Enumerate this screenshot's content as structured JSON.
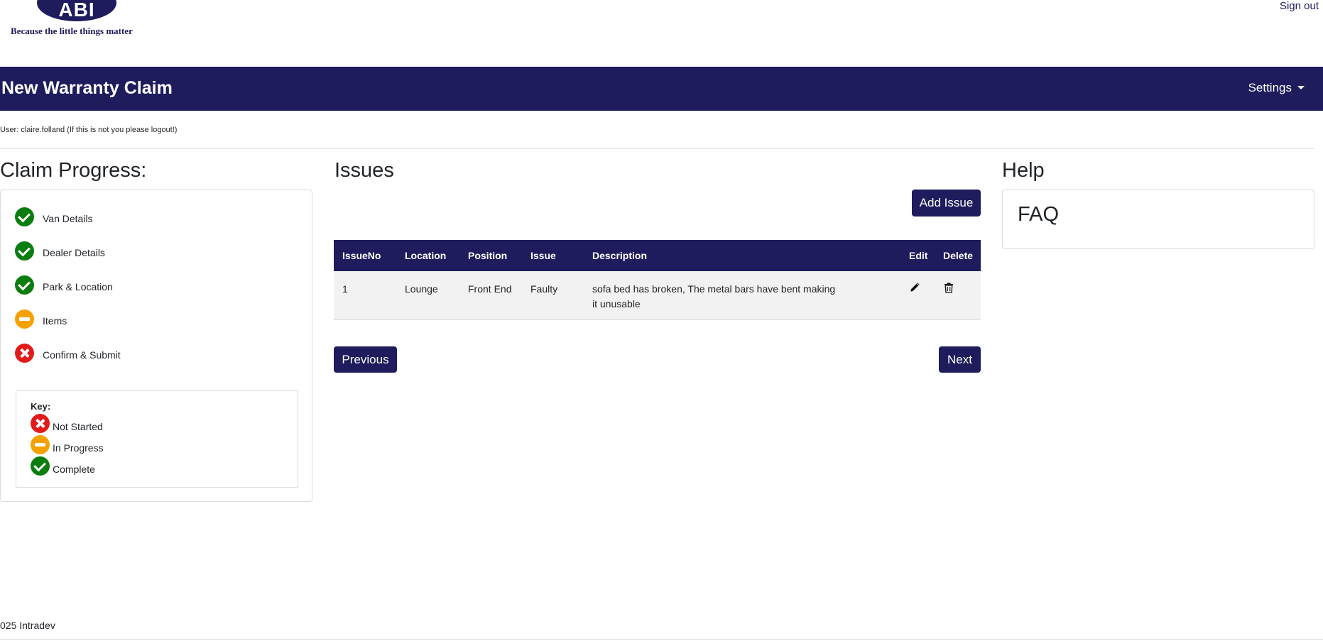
{
  "brand": {
    "logo_text": "ABI",
    "tagline": "Because the little things matter"
  },
  "header": {
    "signout_label": "Sign out"
  },
  "navbar": {
    "title": "New Warranty Claim",
    "settings_label": "Settings"
  },
  "user_line": "User: claire.folland (If this is not you please logout!)",
  "claim_progress": {
    "title": "Claim Progress:",
    "steps": [
      {
        "label": "Van Details",
        "status": "complete"
      },
      {
        "label": "Dealer Details",
        "status": "complete"
      },
      {
        "label": "Park & Location",
        "status": "complete"
      },
      {
        "label": "Items",
        "status": "in-progress"
      },
      {
        "label": "Confirm & Submit",
        "status": "not-started"
      }
    ],
    "key": {
      "title": "Key:",
      "items": [
        {
          "label": "Not Started",
          "status": "not-started"
        },
        {
          "label": "In Progress",
          "status": "in-progress"
        },
        {
          "label": "Complete",
          "status": "complete"
        }
      ]
    }
  },
  "issues": {
    "title": "Issues",
    "add_label": "Add Issue",
    "columns": [
      "IssueNo",
      "Location",
      "Position",
      "Issue",
      "Description",
      "Edit",
      "Delete"
    ],
    "rows": [
      {
        "issue_no": "1",
        "location": "Lounge",
        "position": "Front End",
        "issue": "Faulty",
        "description_line1": "sofa bed has broken, The metal bars have bent making",
        "description_line2": "it unusable"
      }
    ],
    "previous_label": "Previous",
    "next_label": "Next"
  },
  "help": {
    "title": "Help",
    "faq_label": "FAQ"
  },
  "footer": {
    "text": "025 Intradev"
  },
  "colors": {
    "brand_navy": "#1e1c5c",
    "complete": "#0a7d0f",
    "in_progress": "#f5a200",
    "not_started": "#e21b1b"
  },
  "icons": {
    "edit": "pencil-icon",
    "delete": "trash-icon",
    "settings_caret": "caret-down-icon"
  }
}
